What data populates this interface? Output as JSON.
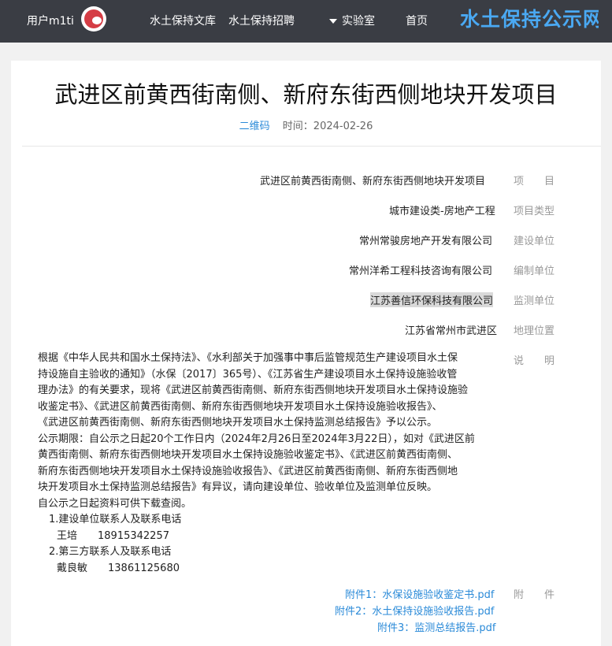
{
  "header": {
    "logo": "水土保持公示网",
    "nav": {
      "home": "首页",
      "lab": "实验室",
      "recruit": "水土保持招聘",
      "library": "水土保持文库"
    },
    "user_name": "用户m1ti"
  },
  "article": {
    "title": "武进区前黄西街南侧、新府东街西侧地块开发项目",
    "time_label": "时间：2024-02-26",
    "author": "二维码",
    "fields": [
      {
        "label": "项　　目",
        "value": "武进区前黄西街南侧、新府东街西侧地块开发项目"
      },
      {
        "label": "项目类型",
        "value": "城市建设类-房地产工程"
      },
      {
        "label": "建设单位",
        "value": "常州常骏房地产开发有限公司"
      },
      {
        "label": "编制单位",
        "value": "常州洋希工程科技咨询有限公司"
      },
      {
        "label": "监测单位",
        "value": "江苏善信环保科技有限公司"
      },
      {
        "label": "地理位置",
        "value": "江苏省常州市武进区"
      }
    ],
    "desc_label": "说　　明",
    "desc_lines": [
      "根据《中华人民共和国水土保持法》、《水利部关于加强事中事后监管规范生产建设项目水土保",
      "持设施自主验收的通知》（水保〔2017〕365号）、《江苏省生产建设项目水土保持设施验收管",
      "理办法》的有关要求，现将《武进区前黄西街南侧、新府东街西侧地块开发项目水土保持设施验",
      "收鉴定书》、《武进区前黄西街南侧、新府东街西侧地块开发项目水土保持设施验收报告》、",
      "《武进区前黄西街南侧、新府东街西侧地块开发项目水土保持监测总结报告》予以公示。",
      "公示期限：自公示之日起20个工作日内（2024年2月26日至2024年3月22日），如对《武进区前",
      "黄西街南侧、新府东街西侧地块开发项目水土保持设施验收鉴定书》、《武进区前黄西街南侧、",
      "新府东街西侧地块开发项目水土保持设施验收报告》、《武进区前黄西街南侧、新府东街西侧地",
      "块开发项目水土保持监测总结报告》有异议，请向建设单位、验收单位及监测单位反映。",
      "自公示之日起资料可供下载查阅。",
      "1.建设单位联系人及联系电话",
      "王培　　18915342257",
      "2.第三方联系人及联系电话",
      "戴良敏　　13861125680"
    ],
    "attach_label": "附　　件",
    "attachments": [
      "附件1：水保设施验收鉴定书.pdf",
      "附件2：水土保持设施验收报告.pdf",
      "附件3：监测总结报告.pdf"
    ]
  }
}
